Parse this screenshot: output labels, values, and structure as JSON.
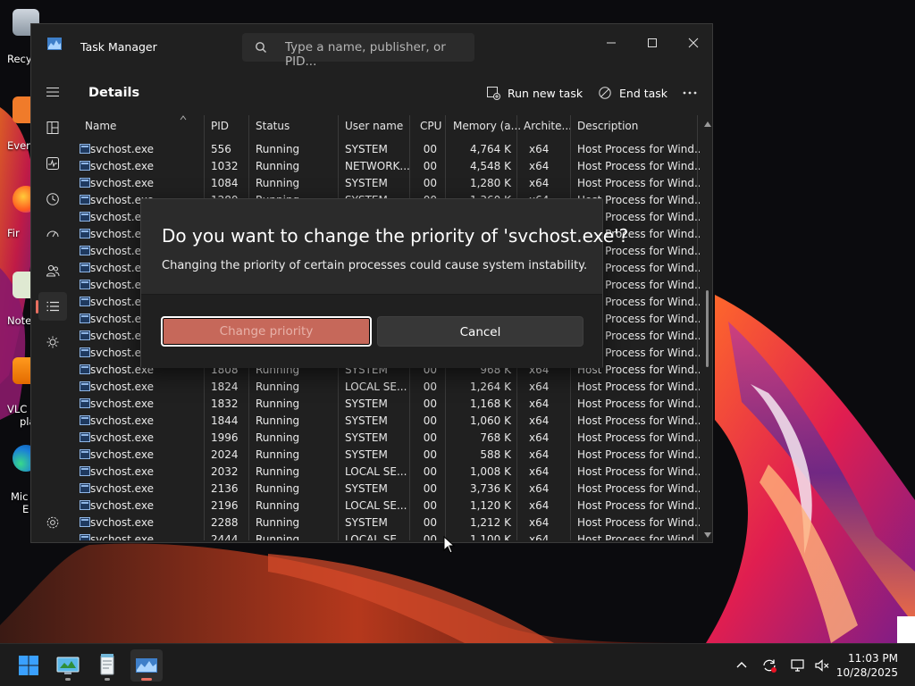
{
  "window": {
    "title": "Task Manager",
    "search_placeholder": "Type a name, publisher, or PID..."
  },
  "desktop_icons": [
    {
      "label": "Recy"
    },
    {
      "label": "Ever"
    },
    {
      "label": "Fir"
    },
    {
      "label": "Note"
    },
    {
      "label": "VLC"
    },
    {
      "label": "pla"
    },
    {
      "label": "Mic"
    },
    {
      "label": "E"
    }
  ],
  "nav": {
    "items": [
      "hamburger",
      "processes",
      "performance",
      "app-history",
      "startup-apps",
      "users",
      "details",
      "services"
    ],
    "active": "details",
    "settings": "settings"
  },
  "page": {
    "title": "Details",
    "run_new_task": "Run new task",
    "end_task": "End task"
  },
  "table": {
    "columns": [
      "Name",
      "PID",
      "Status",
      "User name",
      "CPU",
      "Memory (a...",
      "Archite...",
      "Description"
    ],
    "rows": [
      [
        "svchost.exe",
        "556",
        "Running",
        "SYSTEM",
        "00",
        "4,764 K",
        "x64",
        "Host Process for Wind..."
      ],
      [
        "svchost.exe",
        "1032",
        "Running",
        "NETWORK...",
        "00",
        "4,548 K",
        "x64",
        "Host Process for Wind..."
      ],
      [
        "svchost.exe",
        "1084",
        "Running",
        "SYSTEM",
        "00",
        "1,280 K",
        "x64",
        "Host Process for Wind..."
      ],
      [
        "svchost.exe",
        "1280",
        "Running",
        "SYSTEM",
        "00",
        "1,360 K",
        "x64",
        "Host Process for Wind..."
      ],
      [
        "svchost.exe",
        "",
        "",
        "",
        "",
        "",
        "",
        "Host Process for Wind..."
      ],
      [
        "svchost.exe",
        "",
        "",
        "",
        "",
        "",
        "",
        "Host Process for Wind..."
      ],
      [
        "svchost.exe",
        "",
        "",
        "",
        "",
        "",
        "",
        "Host Process for Wind..."
      ],
      [
        "svchost.exe",
        "",
        "",
        "",
        "",
        "",
        "",
        "Host Process for Wind..."
      ],
      [
        "svchost.exe",
        "",
        "",
        "",
        "",
        "",
        "",
        "Host Process for Wind..."
      ],
      [
        "svchost.exe",
        "",
        "",
        "",
        "",
        "",
        "",
        "Host Process for Wind..."
      ],
      [
        "svchost.exe",
        "",
        "",
        "",
        "",
        "",
        "",
        "Host Process for Wind..."
      ],
      [
        "svchost.exe",
        "",
        "",
        "",
        "",
        "",
        "",
        "Host Process for Wind..."
      ],
      [
        "svchost.exe",
        "",
        "",
        "",
        "",
        "",
        "",
        "Host Process for Wind..."
      ],
      [
        "svchost.exe",
        "1808",
        "Running",
        "SYSTEM",
        "00",
        "968 K",
        "x64",
        "Host Process for Wind..."
      ],
      [
        "svchost.exe",
        "1824",
        "Running",
        "LOCAL SE...",
        "00",
        "1,264 K",
        "x64",
        "Host Process for Wind..."
      ],
      [
        "svchost.exe",
        "1832",
        "Running",
        "SYSTEM",
        "00",
        "1,168 K",
        "x64",
        "Host Process for Wind..."
      ],
      [
        "svchost.exe",
        "1844",
        "Running",
        "SYSTEM",
        "00",
        "1,060 K",
        "x64",
        "Host Process for Wind..."
      ],
      [
        "svchost.exe",
        "1996",
        "Running",
        "SYSTEM",
        "00",
        "768 K",
        "x64",
        "Host Process for Wind..."
      ],
      [
        "svchost.exe",
        "2024",
        "Running",
        "SYSTEM",
        "00",
        "588 K",
        "x64",
        "Host Process for Wind..."
      ],
      [
        "svchost.exe",
        "2032",
        "Running",
        "LOCAL SE...",
        "00",
        "1,008 K",
        "x64",
        "Host Process for Wind..."
      ],
      [
        "svchost.exe",
        "2136",
        "Running",
        "SYSTEM",
        "00",
        "3,736 K",
        "x64",
        "Host Process for Wind..."
      ],
      [
        "svchost.exe",
        "2196",
        "Running",
        "LOCAL SE...",
        "00",
        "1,120 K",
        "x64",
        "Host Process for Wind..."
      ],
      [
        "svchost.exe",
        "2288",
        "Running",
        "SYSTEM",
        "00",
        "1,212 K",
        "x64",
        "Host Process for Wind..."
      ],
      [
        "svchost.exe",
        "2444",
        "Running",
        "LOCAL SE...",
        "00",
        "1,100 K",
        "x64",
        "Host Process for Wind..."
      ]
    ]
  },
  "dialog": {
    "title": "Do you want to change the priority of 'svchost.exe'?",
    "message": "Changing the priority of certain processes could cause system instability.",
    "confirm_label": "Change priority",
    "cancel_label": "Cancel"
  },
  "taskbar": {
    "apps": [
      "start",
      "control-panel",
      "notepad",
      "task-manager"
    ],
    "active_app": "task-manager",
    "tray_icons": [
      "chevron-up",
      "sync",
      "display",
      "volume-muted"
    ],
    "time": "11:03 PM",
    "date": "10/28/2025"
  },
  "colors": {
    "accent": "#e86f60",
    "dialog_primary_button": "#c6685a",
    "window_bg": "#202020",
    "dialog_bg": "#2b2b2b"
  }
}
